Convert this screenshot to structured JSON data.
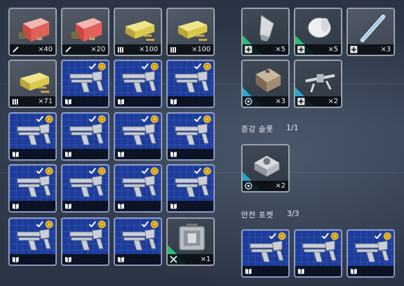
{
  "colors": {
    "blueprint": "#1d3c9a",
    "slot_border": "#c8cdd7",
    "green_rarity": "#2fd47a",
    "cyan_rarity": "#2ab6e6",
    "count_text": "#f2f2f2"
  },
  "inventory": {
    "slots": [
      {
        "icon": "red-supply-crate-icon",
        "type_icon": "medical-tool-icon",
        "count": "×40"
      },
      {
        "icon": "red-supply-crate-icon",
        "type_icon": "medical-tool-icon",
        "count": "×20"
      },
      {
        "icon": "ammo-box-icon",
        "type_icon": "ammo-type-icon",
        "count": "×100"
      },
      {
        "icon": "ammo-box-icon",
        "type_icon": "ammo-type-icon",
        "count": "×100"
      },
      {
        "icon": "ammo-box-icon",
        "type_icon": "ammo-type-icon",
        "count": "×71"
      },
      {
        "icon": "weapon-blueprint-icon",
        "type_icon": "blueprint-book-icon",
        "count": ""
      },
      {
        "icon": "weapon-blueprint-icon",
        "type_icon": "blueprint-book-icon",
        "count": ""
      },
      {
        "icon": "weapon-blueprint-icon",
        "type_icon": "blueprint-book-icon",
        "count": ""
      },
      {
        "icon": "weapon-blueprint-icon",
        "type_icon": "blueprint-book-icon",
        "count": ""
      },
      {
        "icon": "weapon-blueprint-icon",
        "type_icon": "blueprint-book-icon",
        "count": ""
      },
      {
        "icon": "weapon-blueprint-icon",
        "type_icon": "blueprint-book-icon",
        "count": ""
      },
      {
        "icon": "weapon-blueprint-icon",
        "type_icon": "blueprint-book-icon",
        "count": ""
      },
      {
        "icon": "weapon-blueprint-icon",
        "type_icon": "blueprint-book-icon",
        "count": ""
      },
      {
        "icon": "weapon-blueprint-icon",
        "type_icon": "blueprint-book-icon",
        "count": ""
      },
      {
        "icon": "weapon-blueprint-icon",
        "type_icon": "blueprint-book-icon",
        "count": ""
      },
      {
        "icon": "weapon-blueprint-icon",
        "type_icon": "blueprint-book-icon",
        "count": ""
      },
      {
        "icon": "weapon-blueprint-icon",
        "type_icon": "blueprint-book-icon",
        "count": ""
      },
      {
        "icon": "weapon-blueprint-icon",
        "type_icon": "blueprint-book-icon",
        "count": ""
      },
      {
        "icon": "weapon-blueprint-icon",
        "type_icon": "blueprint-book-icon",
        "count": ""
      },
      {
        "icon": "metal-supply-case-icon",
        "type_icon": "crafting-tools-icon",
        "count": "×1"
      }
    ]
  },
  "consumables": {
    "slots": [
      {
        "icon": "grenade-icon",
        "type_icon": "plus-icon",
        "count": "×5"
      },
      {
        "icon": "bandage-roll-icon",
        "type_icon": "plus-icon",
        "count": "×5"
      },
      {
        "icon": "syringe-icon",
        "type_icon": "plus-icon",
        "count": "×3"
      },
      {
        "icon": "mine-device-icon",
        "type_icon": "target-icon",
        "count": "×3"
      },
      {
        "icon": "drone-icon",
        "type_icon": "plus-icon",
        "count": "×2"
      }
    ]
  },
  "augment": {
    "label": "증강 슬롯",
    "count": "1/1",
    "slot": {
      "icon": "augment-device-icon",
      "type_icon": "target-icon",
      "count": "×2"
    }
  },
  "safe_pocket": {
    "label": "안전 포켓",
    "count": "3/3",
    "slots": [
      {
        "icon": "weapon-blueprint-icon",
        "type_icon": "blueprint-book-icon",
        "count": ""
      },
      {
        "icon": "weapon-blueprint-icon",
        "type_icon": "blueprint-book-icon",
        "count": ""
      },
      {
        "icon": "weapon-blueprint-icon",
        "type_icon": "blueprint-book-icon",
        "count": ""
      }
    ]
  }
}
